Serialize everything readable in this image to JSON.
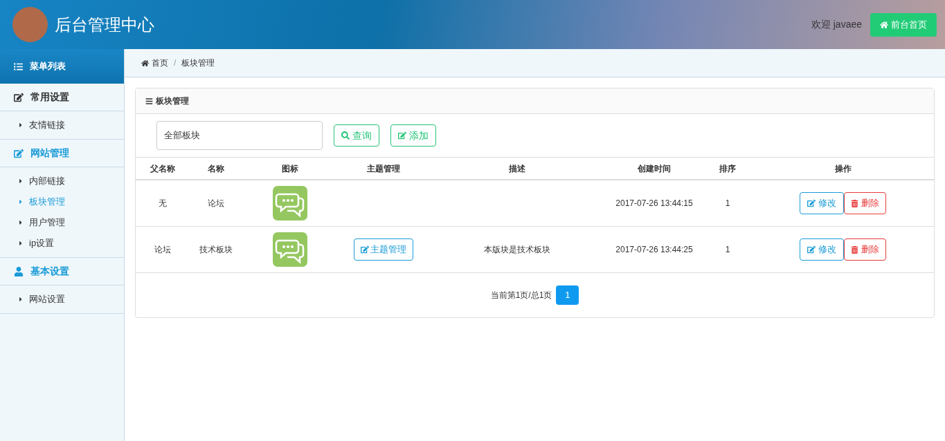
{
  "header": {
    "title": "后台管理中心",
    "welcome": "欢迎 javaee",
    "home_button": "前台首页"
  },
  "sidebar": {
    "title": "菜单列表",
    "groups": [
      {
        "label": "常用设置",
        "kind": "edit",
        "selected": false,
        "items": [
          {
            "label": "友情链接",
            "selected": false
          }
        ]
      },
      {
        "label": "网站管理",
        "kind": "edit",
        "selected": true,
        "items": [
          {
            "label": "内部链接",
            "selected": false
          },
          {
            "label": "板块管理",
            "selected": true
          },
          {
            "label": "用户管理",
            "selected": false
          },
          {
            "label": "ip设置",
            "selected": false
          }
        ]
      },
      {
        "label": "基本设置",
        "kind": "user",
        "selected": true,
        "items": [
          {
            "label": "网站设置",
            "selected": false
          }
        ]
      }
    ]
  },
  "breadcrumb": {
    "separator": "/",
    "items": [
      "首页",
      "板块管理"
    ]
  },
  "panel": {
    "title": "板块管理",
    "filter": {
      "value": "全部板块"
    },
    "search_button": "查询",
    "add_button": "添加"
  },
  "table": {
    "columns": [
      "父名称",
      "名称",
      "图标",
      "主题管理",
      "描述",
      "创建时间",
      "排序",
      "操作"
    ],
    "rows": [
      {
        "parent": "无",
        "name": "论坛",
        "created": "2017-07-26 13:44:15",
        "order": "1",
        "edit": "修改",
        "delete": "删除"
      },
      {
        "parent": "论坛",
        "name": "技术板块",
        "topic_button": "主题管理",
        "description": "本版块是技术板块",
        "created": "2017-07-26 13:44:25",
        "order": "1",
        "edit": "修改",
        "delete": "删除"
      }
    ]
  },
  "pagination": {
    "summary": "当前第1页/总1页",
    "pages": [
      {
        "label": "1",
        "selected": true
      }
    ]
  }
}
